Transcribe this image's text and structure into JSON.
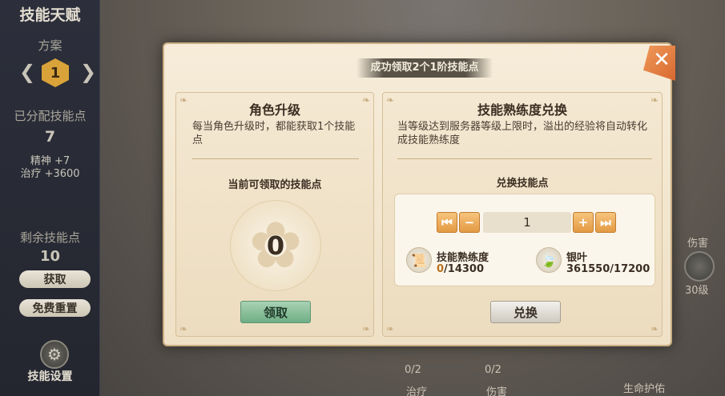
{
  "sidebar": {
    "title": "技能天赋",
    "plan_label": "方案",
    "plan_number": "1",
    "allocated_label": "已分配技能点",
    "allocated_value": "7",
    "bonus_1": "精神 +7",
    "bonus_2": "治疗 +3600",
    "remaining_label": "剩余技能点",
    "remaining_value": "10",
    "get_button": "获取",
    "reset_button": "免费重置",
    "settings_label": "技能设置"
  },
  "background": {
    "node_1_label": "0/2",
    "node_1_name": "治疗",
    "node_2_label": "0/2",
    "node_2_name": "伤害",
    "right_damage": "伤害",
    "right_level": "30级",
    "right_bottom": "生命护佑"
  },
  "modal": {
    "toast": "成功领取2个1阶技能点",
    "close_icon": "close-icon",
    "left": {
      "title": "角色升级",
      "desc": "每当角色升级时，都能获取1个技能点",
      "available_label": "当前可领取的技能点",
      "available_value": "0",
      "claim_button": "领取"
    },
    "right": {
      "title": "技能熟练度兑换",
      "desc": "当等级达到服务器等级上限时，溢出的经验将自动转化成技能熟练度",
      "exchange_label": "兑换技能点",
      "quantity": "1",
      "res1_label": "技能熟练度",
      "res1_have": "0",
      "res1_need": "/14300",
      "res2_label": "银叶",
      "res2_value": "361550/17200",
      "exchange_button": "兑换"
    }
  },
  "colors": {
    "accent_orange": "#e39a43",
    "claim_green": "#6fae85",
    "panel_bg": "#f4e8d2"
  }
}
